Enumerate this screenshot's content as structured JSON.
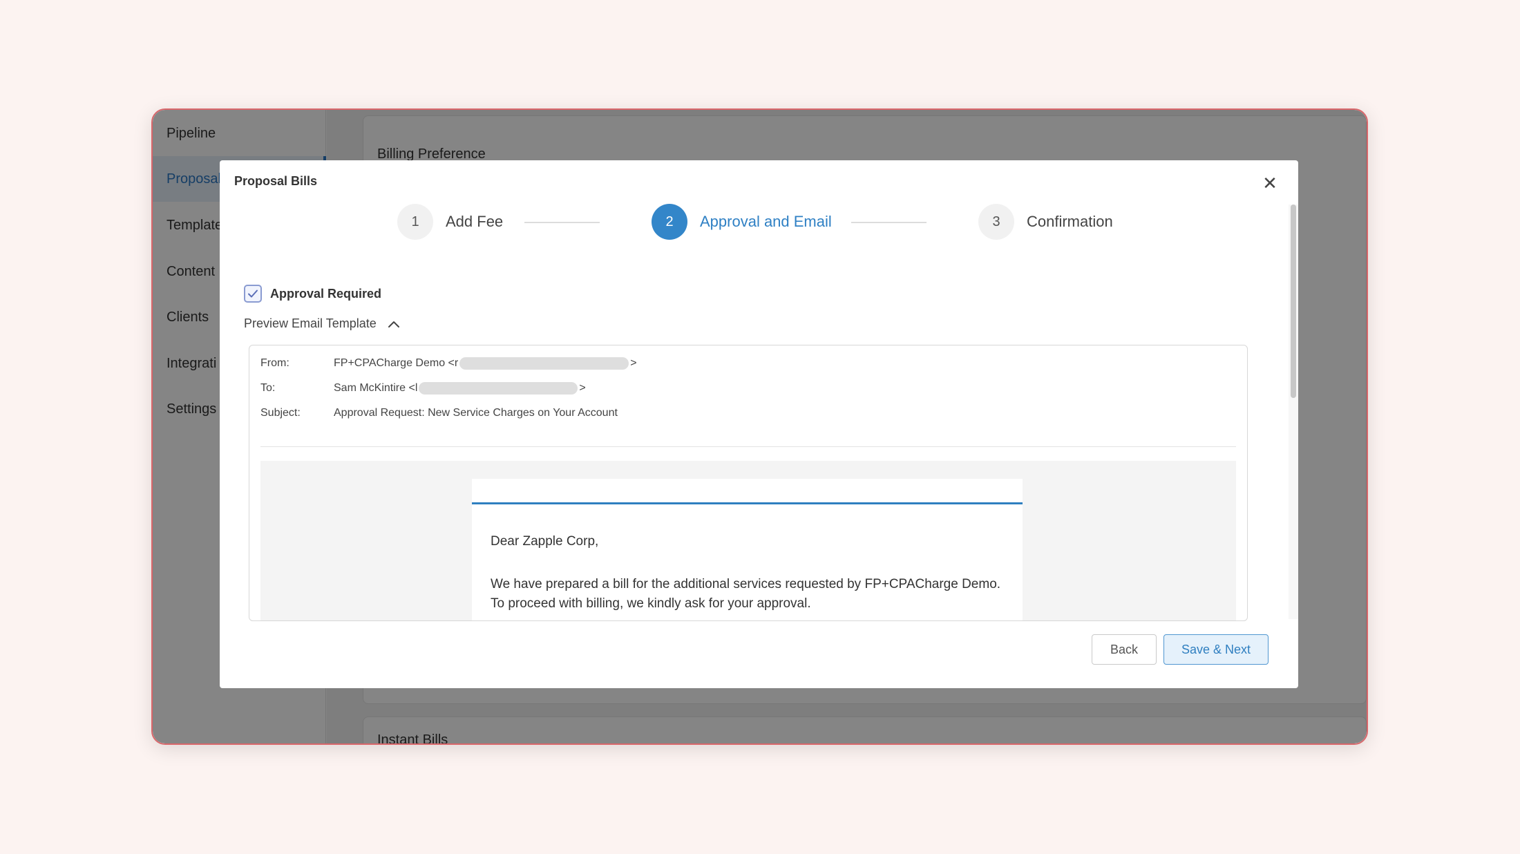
{
  "sidebar": {
    "items": [
      {
        "label": "Pipeline"
      },
      {
        "label": "Proposal"
      },
      {
        "label": "Template"
      },
      {
        "label": "Content"
      },
      {
        "label": "Clients"
      },
      {
        "label": "Integrati"
      },
      {
        "label": "Settings"
      }
    ]
  },
  "background": {
    "billing_preference_title": "Billing Preference",
    "instant_bills_title": "Instant Bills"
  },
  "modal": {
    "title": "Proposal Bills",
    "close_symbol": "✕",
    "steps": [
      {
        "number": "1",
        "label": "Add Fee"
      },
      {
        "number": "2",
        "label": "Approval and Email"
      },
      {
        "number": "3",
        "label": "Confirmation"
      }
    ],
    "approval_label": "Approval Required",
    "approval_checked": true,
    "preview_label": "Preview Email Template",
    "email": {
      "from_key": "From:",
      "from_value": "FP+CPACharge Demo <r",
      "to_key": "To:",
      "to_value": "Sam McKintire <l",
      "subject_key": "Subject:",
      "subject_value": "Approval Request: New Service Charges on Your Account",
      "bracket_close": ">",
      "greeting": "Dear Zapple Corp,",
      "body": "We have prepared a bill for the additional services requested by FP+CPACharge Demo. To proceed with billing, we kindly ask for your approval."
    },
    "back_label": "Back",
    "save_label": "Save & Next"
  },
  "colors": {
    "accent": "#3386c9",
    "frame_border": "#d9666a",
    "page_background": "#fcf3f1"
  },
  "icons": {
    "close": "close-icon",
    "check": "check-icon",
    "chevron": "chevron-up-icon"
  }
}
